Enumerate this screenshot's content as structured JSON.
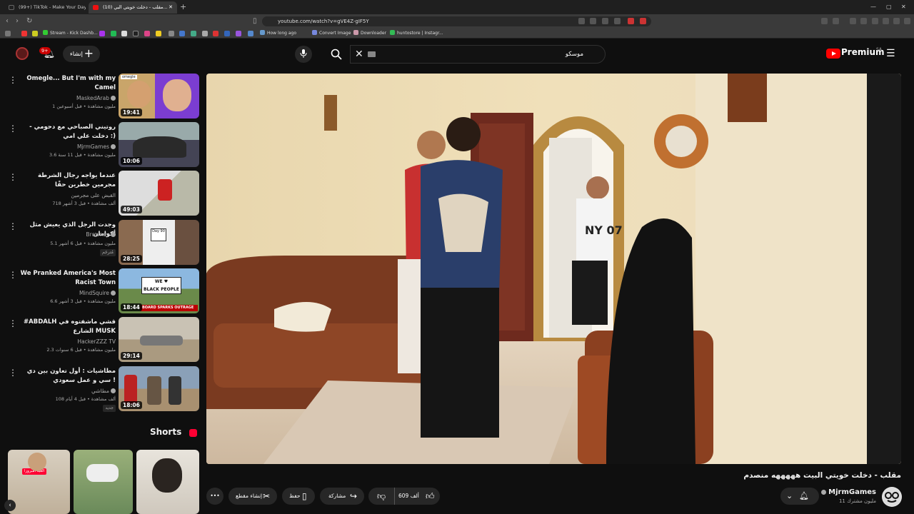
{
  "browser": {
    "tabs": [
      {
        "label": "(99+) TikTok - Make Your Day"
      },
      {
        "label": "(10) مقلب - دخلت خويتي البي..."
      }
    ],
    "url": "youtube.com/watch?v=gVE4Z-gIF5Y",
    "bookmarks": [
      "Stream - Kick Dashb...",
      "How long ago",
      "Convert Image",
      "Downloader",
      "huntostore | Instagr..."
    ]
  },
  "header": {
    "notif_count": "9+",
    "create_label": "إنشاء",
    "search_value": "موسكو",
    "logo_text": "Premium",
    "region": "SA"
  },
  "recommendations": [
    {
      "title": "Omegle... But I'm with my Camel",
      "channel": "MaskedArab",
      "meta": "1 مليون مشاهدة • قبل أسبوعين",
      "duration": "19:41"
    },
    {
      "title": "روتيني الصباحي مع دحومي - دخلت علي امي :)",
      "channel": "MjrmGames",
      "meta": "3.6 مليون مشاهدة • قبل 11 سنة",
      "duration": "10:06"
    },
    {
      "title": "عندما يواجه رجال الشرطة مجرمين خطرين حقًا",
      "channel": "القبض على مجرمين",
      "meta": "718 ألف مشاهدة • قبل 3 أشهر",
      "duration": "49:03"
    },
    {
      "title": "وجدت الرجل الذي يعيش مثل أكوامان",
      "channel": "Browney",
      "meta": "5.1 مليون مشاهدة • قبل 6 أشهر",
      "duration": "28:25",
      "badge": "مُترجَم"
    },
    {
      "title": "We Pranked America's Most Racist Town",
      "channel": "MindSquire",
      "meta": "6.6 مليون مشاهدة • قبل 3 أشهر",
      "duration": "18:44"
    },
    {
      "title": "#ABDALH قشي ماشفتوه في الشارع MUSK",
      "channel": "HackerZZZ TV",
      "meta": "2.3 مليون مشاهدة • قبل 6 سنوات",
      "duration": "29:14"
    },
    {
      "title": "مطاشيات : أول تعاون بين دي سي و عمل سعودي !",
      "channel": "مطاشي",
      "meta": "108 ألف مشاهدة • قبل 4 أيام",
      "duration": "18:06",
      "badge": "جديد"
    }
  ],
  "thumb_texts": {
    "t1": "omegle",
    "t4": "Day 90",
    "t5a": "WE ♥",
    "t5b": "BLACK PEOPLE",
    "t5c": "BOARD SPARKS OUTRAGE"
  },
  "shorts": {
    "title": "Shorts",
    "tag": "العبة امبروزا"
  },
  "video": {
    "title": "مقلب - دخلت خويتي البيت هههههه منصدم",
    "channel": "MjrmGames",
    "subscribers": "11 مليون مشترك",
    "likes": "609 ألف",
    "share": "مشاركة",
    "save": "حفظ",
    "clip": "إنشاء مقطع",
    "shirt_text": "NY 07"
  },
  "colors": {
    "accent": "#ff0000",
    "bg": "#0f0f0f",
    "chip": "#272727"
  }
}
